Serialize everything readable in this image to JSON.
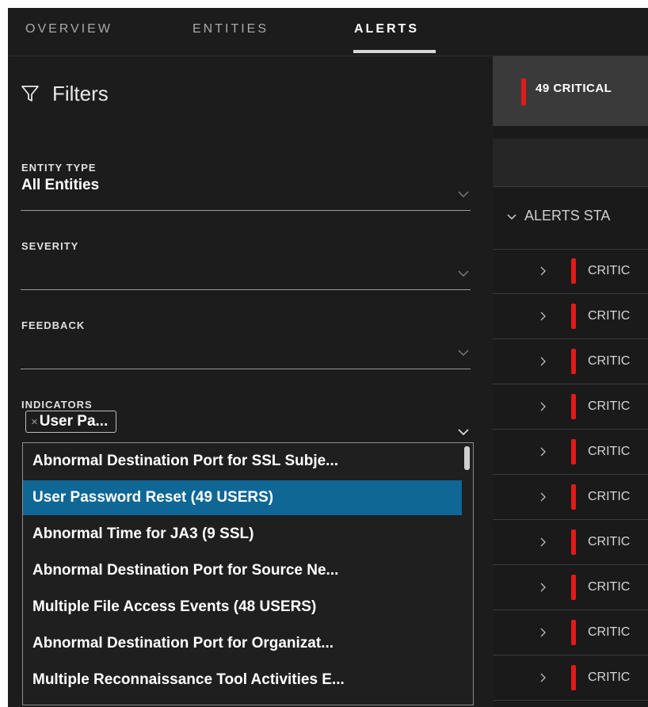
{
  "tabs": [
    {
      "label": "OVERVIEW",
      "active": false
    },
    {
      "label": "ENTITIES",
      "active": false
    },
    {
      "label": "ALERTS",
      "active": true
    }
  ],
  "filters": {
    "title": "Filters",
    "entity_type": {
      "label": "ENTITY TYPE",
      "value": "All Entities"
    },
    "severity": {
      "label": "SEVERITY",
      "value": ""
    },
    "feedback": {
      "label": "FEEDBACK",
      "value": ""
    },
    "indicators": {
      "label": "INDICATORS",
      "selected_tag": "User Pa...",
      "options": [
        {
          "label": "Abnormal Destination Port for SSL Subje...",
          "selected": false
        },
        {
          "label": "User Password Reset (49 USERS)",
          "selected": true
        },
        {
          "label": "Abnormal Time for JA3 (9 SSL)",
          "selected": false
        },
        {
          "label": "Abnormal Destination Port for Source Ne...",
          "selected": false
        },
        {
          "label": "Multiple File Access Events (48 USERS)",
          "selected": false
        },
        {
          "label": "Abnormal Destination Port for Organizat...",
          "selected": false
        },
        {
          "label": "Multiple Reconnaissance Tool Activities E...",
          "selected": false
        }
      ]
    }
  },
  "summary": {
    "text": "49 CRITICAL"
  },
  "alerts_section": {
    "title": "ALERTS STA"
  },
  "alerts": [
    {
      "severity": "CRITIC"
    },
    {
      "severity": "CRITIC"
    },
    {
      "severity": "CRITIC"
    },
    {
      "severity": "CRITIC"
    },
    {
      "severity": "CRITIC"
    },
    {
      "severity": "CRITIC"
    },
    {
      "severity": "CRITIC"
    },
    {
      "severity": "CRITIC"
    },
    {
      "severity": "CRITIC"
    },
    {
      "severity": "CRITIC"
    }
  ],
  "colors": {
    "critical": "#e01b1b",
    "selected_option": "#0f6796",
    "background": "#1c1c1c"
  }
}
